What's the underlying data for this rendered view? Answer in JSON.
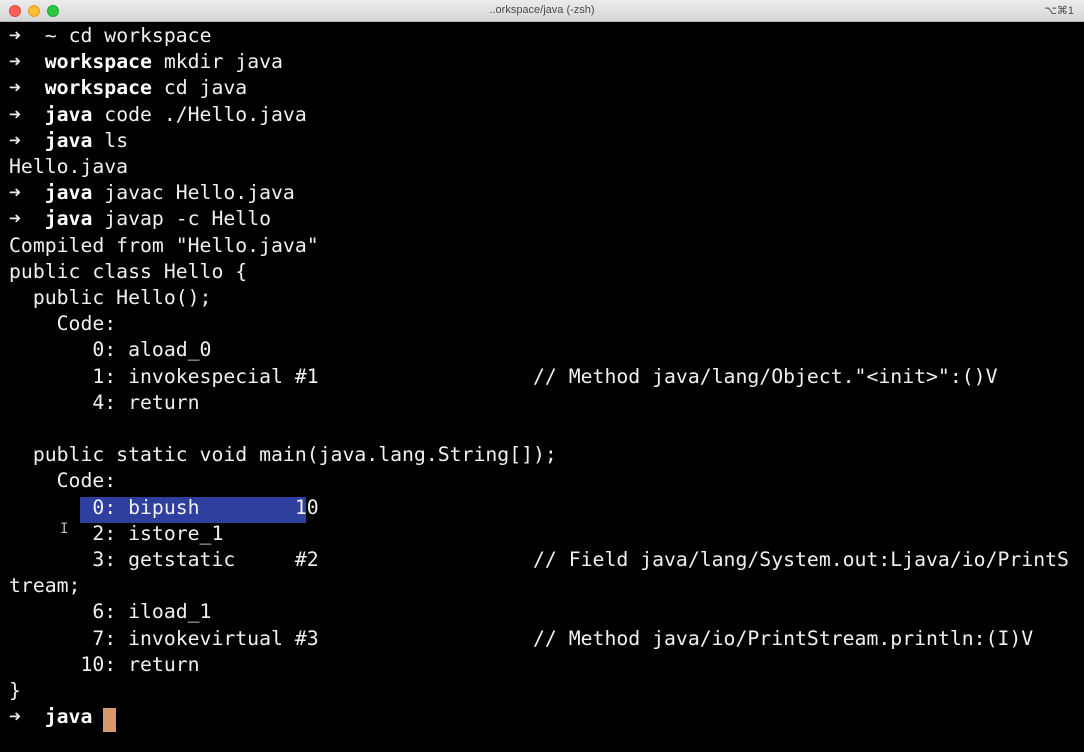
{
  "window": {
    "title": "..orkspace/java (-zsh)",
    "shortcut": "⌥⌘1"
  },
  "terminal": {
    "lines": [
      "➜  ~ cd workspace",
      "➜  workspace mkdir java",
      "➜  workspace cd java",
      "➜  java code ./Hello.java",
      "➜  java ls",
      "Hello.java",
      "➜  java javac Hello.java",
      "➜  java javap -c Hello",
      "Compiled from \"Hello.java\"",
      "public class Hello {",
      "  public Hello();",
      "    Code:",
      "       0: aload_0",
      "       1: invokespecial #1                  // Method java/lang/Object.\"<init>\":()V",
      "       4: return",
      "",
      "  public static void main(java.lang.String[]);",
      "    Code:",
      "       0: bipush        10",
      "       2: istore_1",
      "       3: getstatic     #2                  // Field java/lang/System.out:Ljava/io/PrintS",
      "tream;",
      "       6: iload_1",
      "       7: invokevirtual #3                  // Method java/io/PrintStream.println:(I)V",
      "      10: return",
      "}",
      "➜  java "
    ],
    "prompt_dirs": {
      "0": "~",
      "1": "workspace",
      "2": "workspace",
      "3": "java",
      "4": "java",
      "6": "java",
      "7": "java",
      "26": "java"
    }
  },
  "colors": {
    "background": "#000000",
    "foreground": "#f0f0f0",
    "selection": "#2f3f9d",
    "cursor": "#d89a6a"
  }
}
